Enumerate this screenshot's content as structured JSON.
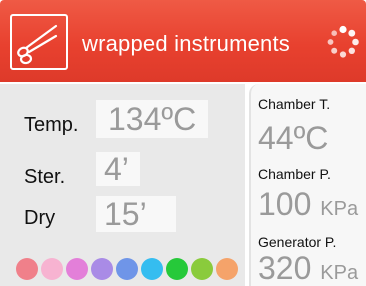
{
  "header": {
    "title": "wrapped instruments",
    "logo_icon": "scissors-icon",
    "status_icon": "loading-spinner-icon",
    "background_color": "#e8412f"
  },
  "cycle": {
    "temp": {
      "label": "Temp.",
      "value": "134ºC"
    },
    "ster": {
      "label": "Ster.",
      "value": "4’"
    },
    "dry": {
      "label": "Dry",
      "value": "15’"
    }
  },
  "color_dots": [
    "#f0808a",
    "#f7b3d1",
    "#e37fd9",
    "#a98be6",
    "#6f95e8",
    "#35bdf0",
    "#26c93a",
    "#8acb3c",
    "#f5a36a"
  ],
  "readings": {
    "chamber_temp": {
      "label": "Chamber T.",
      "value": "44ºC",
      "unit": ""
    },
    "chamber_pressure": {
      "label": "Chamber P.",
      "value": "100",
      "unit": "KPa"
    },
    "generator_pressure": {
      "label": "Generator P.",
      "value": "320",
      "unit": "KPa"
    }
  }
}
